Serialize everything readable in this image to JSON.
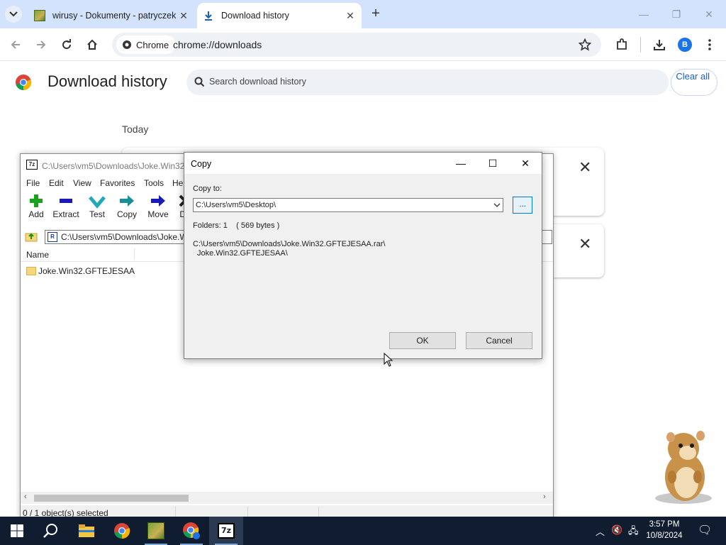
{
  "browser": {
    "tabs": [
      {
        "title": "wirusy - Dokumenty - patryczek",
        "active": false
      },
      {
        "title": "Download history",
        "active": true
      }
    ],
    "omnibox": {
      "chip_label": "Chrome",
      "url": "chrome://downloads"
    },
    "avatar_letter": "B"
  },
  "downloads_page": {
    "title": "Download history",
    "search_placeholder": "Search download history",
    "clear_all_label": "Clear all",
    "section_label": "Today"
  },
  "sevenzip": {
    "title": "C:\\Users\\vm5\\Downloads\\Joke.Win32",
    "icon_label": "7z",
    "menu": [
      "File",
      "Edit",
      "View",
      "Favorites",
      "Tools",
      "He"
    ],
    "toolbar": [
      "Add",
      "Extract",
      "Test",
      "Copy",
      "Move",
      "De"
    ],
    "path": "C:\\Users\\vm5\\Downloads\\Joke.W",
    "column_name": "Name",
    "items": [
      "Joke.Win32.GFTEJESAA"
    ],
    "status": "0 / 1 object(s) selected"
  },
  "copy_dialog": {
    "title": "Copy",
    "copy_to_label": "Copy to:",
    "destination": "C:\\Users\\vm5\\Desktop\\",
    "browse_label": "...",
    "info": "Folders: 1    ( 569 bytes )",
    "source_line_1": "C:\\Users\\vm5\\Downloads\\Joke.Win32.GFTEJESAA.rar\\",
    "source_line_2": "Joke.Win32.GFTEJESAA\\",
    "ok_label": "OK",
    "cancel_label": "Cancel"
  },
  "taskbar": {
    "time": "3:57 PM",
    "date": "10/8/2024",
    "active_app": "7-Zip"
  },
  "colors": {
    "tabstrip": "#d3e3fd",
    "taskbar": "#101d30",
    "accent": "#1a73e8",
    "dialog_bg": "#f0f0f0"
  }
}
